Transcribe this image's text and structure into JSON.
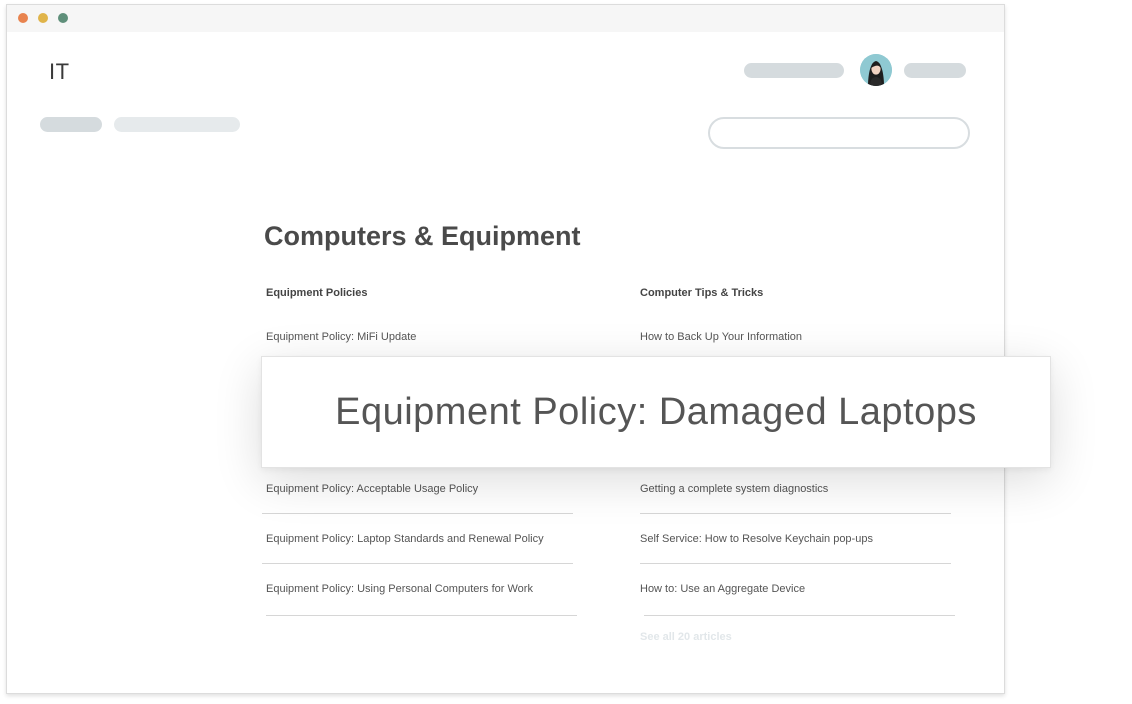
{
  "window": {
    "controls": [
      {
        "name": "close",
        "color": "#e8834e"
      },
      {
        "name": "minimize",
        "color": "#e0b44a"
      },
      {
        "name": "zoom",
        "color": "#5f8f7a"
      }
    ]
  },
  "header": {
    "brand": "IT",
    "placeholder_color": "#d5dbde",
    "placeholder_light_color": "#e6eaec"
  },
  "search": {
    "value": "",
    "placeholder": ""
  },
  "section": {
    "title": "Computers & Equipment"
  },
  "columns": [
    {
      "title": "Equipment Policies",
      "articles": [
        "Equipment Policy: MiFi Update",
        "Equipment Policy: Acceptable Usage Policy",
        "Equipment Policy: Laptop Standards and Renewal Policy",
        "Equipment Policy: Using Personal Computers for Work"
      ]
    },
    {
      "title": "Computer Tips & Tricks",
      "articles": [
        "How to Back Up Your Information",
        "Getting a complete system diagnostics",
        "Self Service: How to Resolve Keychain pop-ups",
        "How to: Use an Aggregate Device"
      ],
      "see_all": "See all 20 articles"
    }
  ],
  "highlight": {
    "text": "Equipment Policy: Damaged Laptops"
  }
}
